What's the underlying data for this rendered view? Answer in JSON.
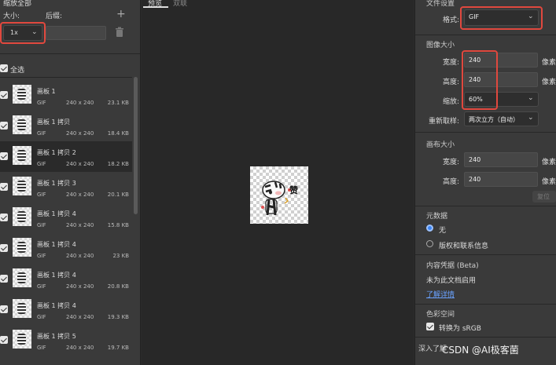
{
  "left": {
    "section_title": "缩放全部",
    "size_label": "大小:",
    "suffix_label": "后缀:",
    "add_icon": "+",
    "scale_value": "1x",
    "select_all": "全选",
    "rows": [
      {
        "name": "画板 1",
        "format": "GIF",
        "dims": "240 x 240",
        "size": "23.1 KB"
      },
      {
        "name": "画板 1 拷贝",
        "format": "GIF",
        "dims": "240 x 240",
        "size": "18.4 KB"
      },
      {
        "name": "画板 1 拷贝 2",
        "format": "GIF",
        "dims": "240 x 240",
        "size": "18.2 KB"
      },
      {
        "name": "画板 1 拷贝 3",
        "format": "GIF",
        "dims": "240 x 240",
        "size": "20.1 KB"
      },
      {
        "name": "画板 1 拷贝 4",
        "format": "GIF",
        "dims": "240 x 240",
        "size": "15.8 KB"
      },
      {
        "name": "画板 1 拷贝 4",
        "format": "GIF",
        "dims": "240 x 240",
        "size": "23 KB"
      },
      {
        "name": "画板 1 拷贝 4",
        "format": "GIF",
        "dims": "240 x 240",
        "size": "20.8 KB"
      },
      {
        "name": "画板 1 拷贝 4",
        "format": "GIF",
        "dims": "240 x 240",
        "size": "19.3 KB"
      },
      {
        "name": "画板 1 拷贝 5",
        "format": "GIF",
        "dims": "240 x 240",
        "size": "19.7 KB"
      }
    ]
  },
  "center": {
    "tab_preview": "预览",
    "tab_dual": "双联",
    "preview_glyph": "赞"
  },
  "right": {
    "file_settings": "文件设置",
    "format_label": "格式:",
    "format_value": "GIF",
    "image_size": "图像大小",
    "width_label": "宽度:",
    "width_value": "240",
    "height_label": "高度:",
    "height_value": "240",
    "scale_label": "缩放:",
    "scale_value": "60%",
    "unit": "像素",
    "resample_label": "重新取样:",
    "resample_value": "两次立方（自动）",
    "canvas_size": "画布大小",
    "canvas_width_label": "宽度:",
    "canvas_width_value": "240",
    "canvas_height_label": "高度:",
    "canvas_height_value": "240",
    "restore_button": "复位",
    "metadata": "元数据",
    "metadata_none": "无",
    "metadata_copyright": "版权和联系信息",
    "content_credentials": "内容凭据 (Beta)",
    "not_enabled": "未为此文档启用",
    "learn_more": "了解详情",
    "color_space": "色彩空间",
    "convert_srgb": "转换为 sRGB",
    "learn_more_bottom": "深入了解"
  },
  "watermark": "CSDN @AI极客菌",
  "colors": {
    "highlight": "#e0483e",
    "radio": "#3d86f5",
    "link": "#6aa2ff"
  }
}
